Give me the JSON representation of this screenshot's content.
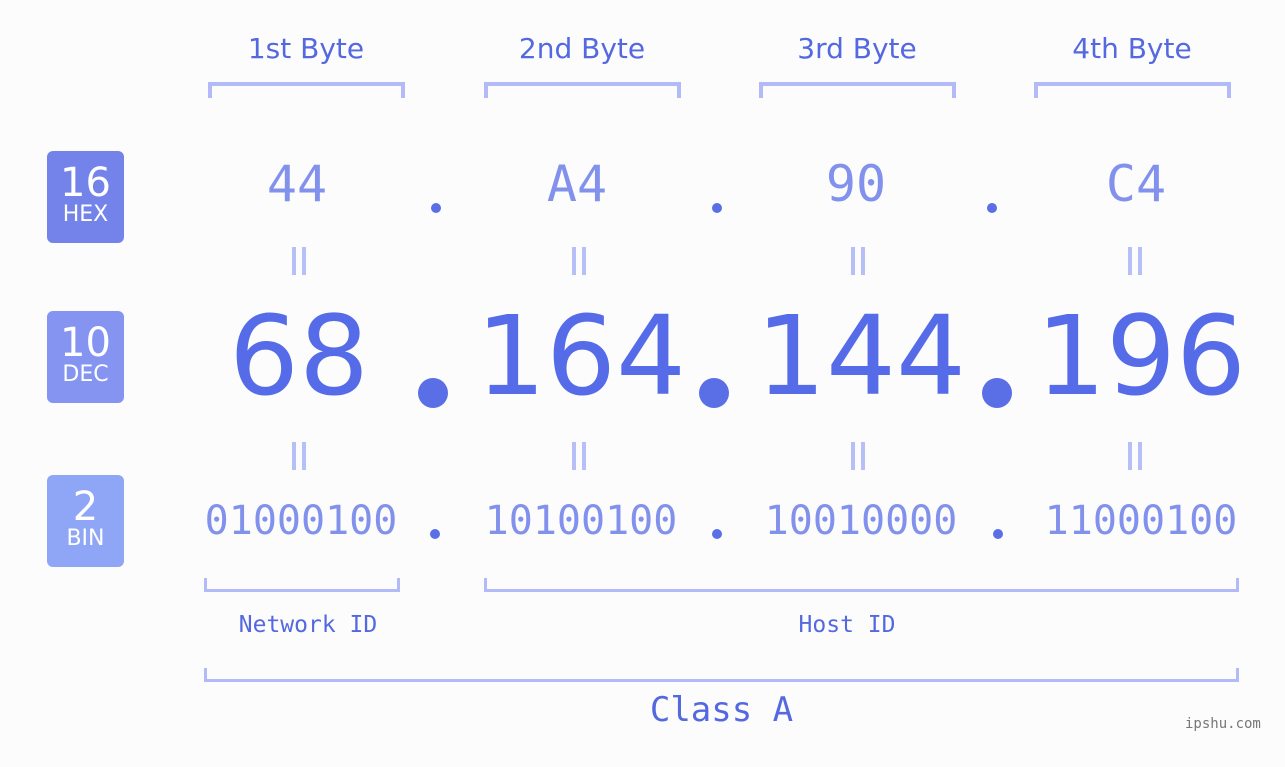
{
  "byte_headers": [
    "1st Byte",
    "2nd Byte",
    "3rd Byte",
    "4th Byte"
  ],
  "badges": {
    "hex": {
      "number": "16",
      "label": "HEX",
      "color": "#7483ea"
    },
    "dec": {
      "number": "10",
      "label": "DEC",
      "color": "#8494f0"
    },
    "bin": {
      "number": "2",
      "label": "BIN",
      "color": "#8fa6f6"
    }
  },
  "hex_values": [
    "44",
    "A4",
    "90",
    "C4"
  ],
  "dec_values": [
    "68",
    "164",
    "144",
    "196"
  ],
  "bin_values": [
    "01000100",
    "10100100",
    "10010000",
    "11000100"
  ],
  "separator": ".",
  "network_id_label": "Network ID",
  "host_id_label": "Host ID",
  "class_label": "Class A",
  "watermark": "ipshu.com",
  "colors": {
    "accent": "#5468e0",
    "bracket": "#b2bbf7",
    "value_light": "#8291ec",
    "value_dark": "#566be8",
    "background": "#fbfcfb"
  }
}
